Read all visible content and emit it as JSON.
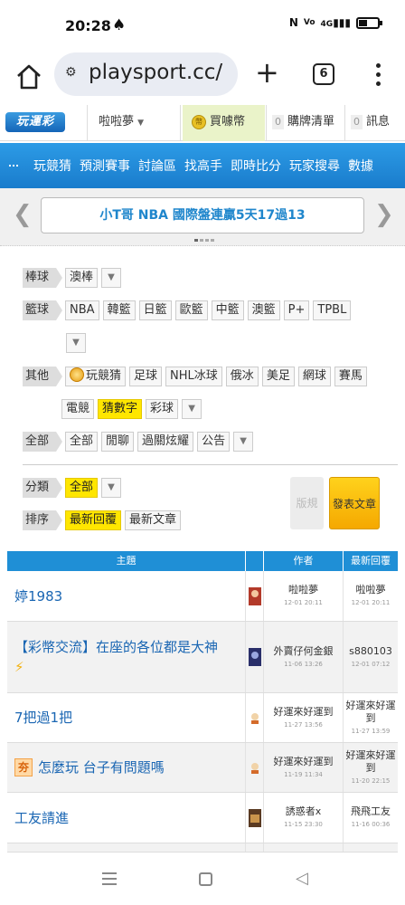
{
  "status_bar": {
    "time": "20:28",
    "network": "4G"
  },
  "browser": {
    "url": "playsport.cc/",
    "tab_count": "6"
  },
  "site_header": {
    "logo": "玩運彩",
    "username": "啦啦夢",
    "coin_icon": "幣",
    "coin_label": "買噱幣",
    "cart_count": "0",
    "cart_label": "購牌清單",
    "msg_count": "0",
    "msg_label": "訊息"
  },
  "nav": {
    "items": [
      "玩競猜",
      "預測賽事",
      "討論區",
      "找高手",
      "即時比分",
      "玩家搜尋",
      "數據"
    ]
  },
  "marquee": {
    "text": "小T哥 NBA 國際盤連贏5天17過13"
  },
  "filters": {
    "baseball": {
      "label": "棒球",
      "chips": [
        "澳棒"
      ]
    },
    "basketball": {
      "label": "籃球",
      "chips": [
        "NBA",
        "韓籃",
        "日籃",
        "歐籃",
        "中籃",
        "澳籃",
        "P+",
        "TPBL"
      ]
    },
    "other": {
      "label": "其他",
      "chips": [
        "玩競猜",
        "足球",
        "NHL冰球",
        "俄冰",
        "美足",
        "網球",
        "賽馬"
      ],
      "chips2": [
        "電競",
        "猜數字",
        "彩球"
      ]
    },
    "all": {
      "label": "全部",
      "chips": [
        "全部",
        "閒聊",
        "過關炫耀",
        "公告"
      ]
    },
    "category": {
      "label": "分類",
      "selected": "全部"
    },
    "sort": {
      "label": "排序",
      "options": [
        "最新回覆",
        "最新文章"
      ]
    }
  },
  "buttons": {
    "rules": "版規",
    "post": "發表文章"
  },
  "table": {
    "headers": {
      "topic": "主題",
      "author": "作者",
      "latest": "最新回覆"
    },
    "rows": [
      {
        "title": "婷1983",
        "tag": "",
        "author": "啦啦夢",
        "author_time": "12-01 20:11",
        "reply_user": "啦啦夢",
        "reply_time": "12-01 20:11"
      },
      {
        "title": "【彩幣交流】在座的各位都是大神",
        "tag": "",
        "author": "外賣仔何金銀",
        "author_time": "11-06 13:26",
        "reply_user": "s880103",
        "reply_time": "12-01 07:12"
      },
      {
        "title": "7把過1把",
        "tag": "",
        "author": "好運來好運到",
        "author_time": "11-27 13:56",
        "reply_user": "好運來好運到",
        "reply_time": "11-27 13:59"
      },
      {
        "title": "怎麼玩 台子有問題嗎",
        "tag": "夯",
        "author": "好運來好運到",
        "author_time": "11-19 11:34",
        "reply_user": "好運來好運到",
        "reply_time": "11-20 22:15"
      },
      {
        "title": "工友請進",
        "tag": "",
        "author": "誘惑者x",
        "author_time": "11-15 23:30",
        "reply_user": "飛飛工友",
        "reply_time": "11-16 00:36"
      }
    ]
  }
}
